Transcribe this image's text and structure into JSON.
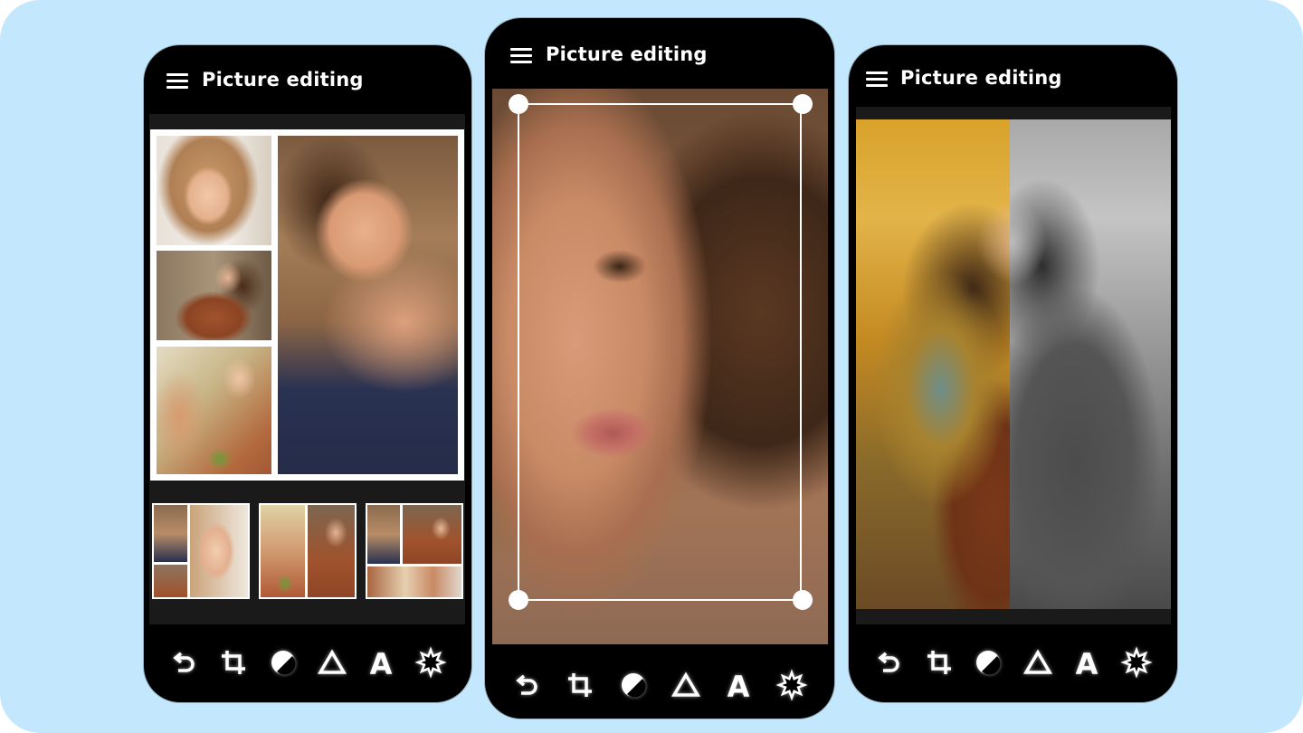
{
  "app": {
    "background_color": "#c3e8fd",
    "accent_color": "#ffffff",
    "phone_color": "#000000"
  },
  "phones": [
    {
      "title": "Picture editing",
      "menu_icon": "hamburger-menu-icon",
      "mode": "collage-layout",
      "collage_layouts_count": 3,
      "tools": [
        {
          "name": "undo",
          "icon": "undo-icon"
        },
        {
          "name": "crop",
          "icon": "crop-icon"
        },
        {
          "name": "contrast",
          "icon": "contrast-icon"
        },
        {
          "name": "shape",
          "icon": "triangle-icon"
        },
        {
          "name": "text",
          "icon": "text-icon",
          "glyph": "A"
        },
        {
          "name": "effects",
          "icon": "sparkle-icon"
        }
      ]
    },
    {
      "title": "Picture editing",
      "menu_icon": "hamburger-menu-icon",
      "mode": "crop",
      "tools": [
        {
          "name": "undo",
          "icon": "undo-icon"
        },
        {
          "name": "crop",
          "icon": "crop-icon"
        },
        {
          "name": "contrast",
          "icon": "contrast-icon"
        },
        {
          "name": "shape",
          "icon": "triangle-icon"
        },
        {
          "name": "text",
          "icon": "text-icon",
          "glyph": "A"
        },
        {
          "name": "effects",
          "icon": "sparkle-icon"
        }
      ]
    },
    {
      "title": "Picture editing",
      "menu_icon": "hamburger-menu-icon",
      "mode": "color-vs-grayscale-split",
      "tools": [
        {
          "name": "undo",
          "icon": "undo-icon"
        },
        {
          "name": "crop",
          "icon": "crop-icon"
        },
        {
          "name": "contrast",
          "icon": "contrast-icon"
        },
        {
          "name": "shape",
          "icon": "triangle-icon"
        },
        {
          "name": "text",
          "icon": "text-icon",
          "glyph": "A"
        },
        {
          "name": "effects",
          "icon": "sparkle-icon"
        }
      ]
    }
  ]
}
